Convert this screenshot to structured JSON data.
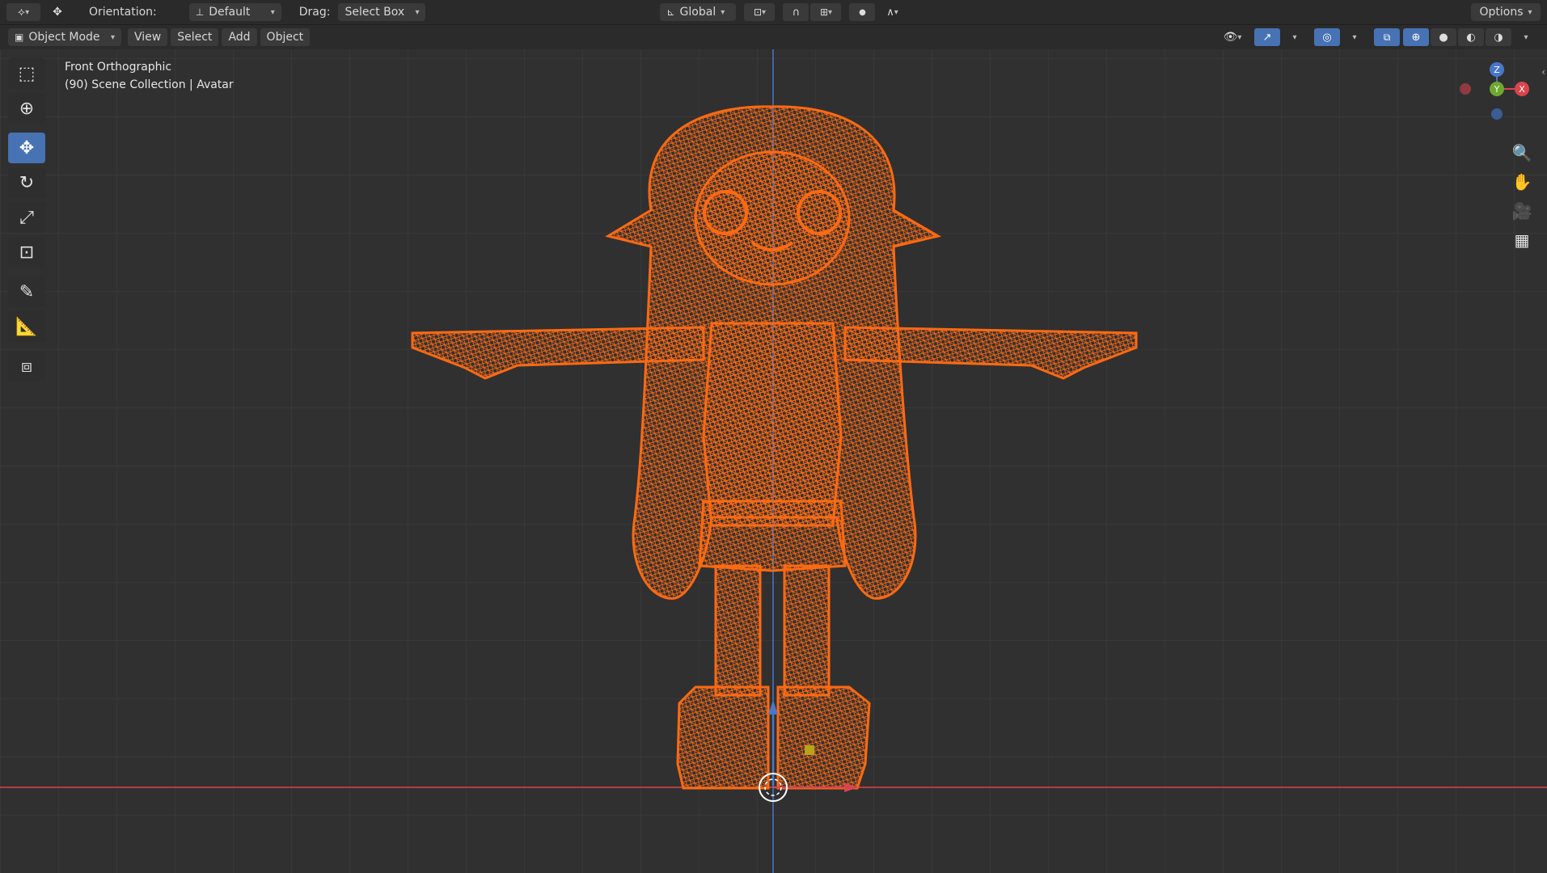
{
  "header": {
    "transform_icon": "move-icon",
    "orientation_label": "Orientation:",
    "orientation_value": "Default",
    "drag_label": "Drag:",
    "drag_value": "Select Box",
    "transform_orientation": "Global",
    "options_label": "Options"
  },
  "subheader": {
    "mode": "Object Mode",
    "menus": [
      "View",
      "Select",
      "Add",
      "Object"
    ]
  },
  "viewport": {
    "view_name": "Front Orthographic",
    "collection_info": "(90) Scene Collection | Avatar",
    "gizmo": {
      "z_label": "Z",
      "y_label": "Y",
      "x_label": "X"
    },
    "colors": {
      "background": "#303030",
      "grid": "#3d3d3d",
      "x_axis": "#d8454d",
      "z_axis": "#4877c9",
      "wireframe": "#ff6a13",
      "selected": "#4772b3"
    }
  },
  "tools": [
    {
      "name": "select-box-tool",
      "icon": "cursor-select-icon"
    },
    {
      "name": "cursor-tool",
      "icon": "3d-cursor-icon"
    },
    {
      "name": "move-tool",
      "icon": "move-icon",
      "active": true
    },
    {
      "name": "rotate-tool",
      "icon": "rotate-icon"
    },
    {
      "name": "scale-tool",
      "icon": "scale-icon"
    },
    {
      "name": "transform-tool",
      "icon": "transform-icon"
    },
    {
      "name": "annotate-tool",
      "icon": "annotate-icon"
    },
    {
      "name": "measure-tool",
      "icon": "measure-icon"
    },
    {
      "name": "add-cube-tool",
      "icon": "add-cube-icon"
    }
  ]
}
